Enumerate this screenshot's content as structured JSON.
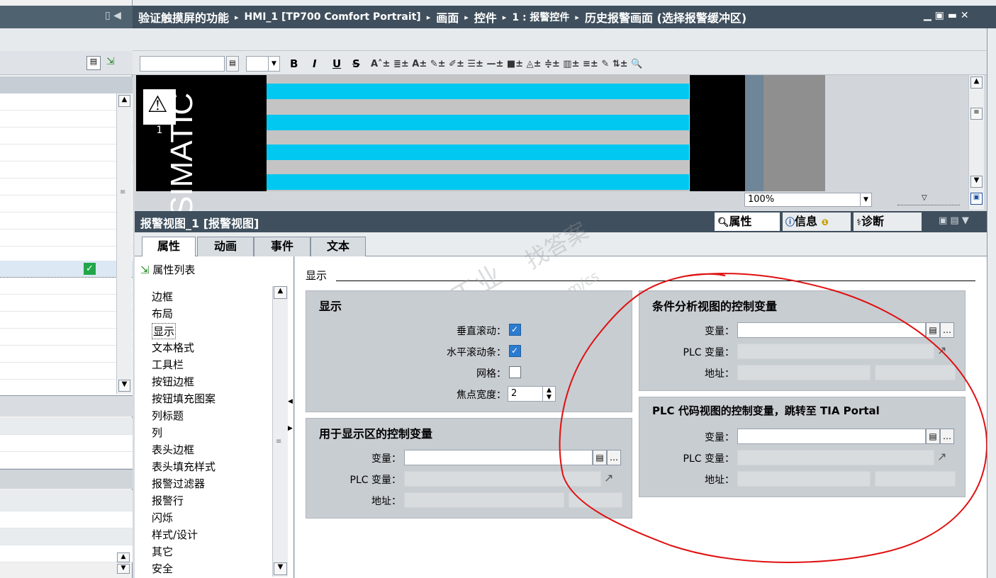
{
  "breadcrumb": {
    "items": [
      "验证触摸屏的功能",
      "HMI_1 [TP700 Comfort Portrait]",
      "画面",
      "控件",
      "1 : 报警控件",
      "历史报警画面 (选择报警缓冲区)"
    ],
    "separator": "▸"
  },
  "toolbar": {
    "bold": "B",
    "italic": "I",
    "underline": "U",
    "strike": "S"
  },
  "canvas": {
    "brand_text": "SIMATIC",
    "badge_number": "1",
    "zoom": "100%"
  },
  "properties_bar": {
    "title": "报警视图_1 [报警视图]",
    "tab_properties": "属性",
    "tab_info": "信息",
    "tab_diag": "诊断"
  },
  "tabs": [
    "属性",
    "动画",
    "事件",
    "文本"
  ],
  "nav": {
    "header": "属性列表",
    "items": [
      "边框",
      "布局",
      "显示",
      "文本格式",
      "工具栏",
      "按钮边框",
      "按钮填充图案",
      "列标题",
      "列",
      "表头边框",
      "表头填充样式",
      "报警过滤器",
      "报警行",
      "闪烁",
      "样式/设计",
      "其它",
      "安全"
    ]
  },
  "section_title": "显示",
  "display_group": {
    "title": "显示",
    "vscroll_label": "垂直滚动：",
    "hscroll_label": "水平滚动条：",
    "grid_label": "网格：",
    "focus_label": "焦点宽度：",
    "focus_value": "2"
  },
  "display_area_group": {
    "title": "用于显示区的控制变量",
    "var_label": "变量：",
    "plc_label": "PLC 变量：",
    "addr_label": "地址："
  },
  "condition_group": {
    "title": "条件分析视图的控制变量",
    "var_label": "变量：",
    "plc_label": "PLC 变量：",
    "addr_label": "地址："
  },
  "plc_code_group": {
    "title": "PLC 代码视图的控制变量，跳转至 TIA Portal",
    "var_label": "变量：",
    "plc_label": "PLC 变量：",
    "addr_label": "地址："
  },
  "watermark": {
    "line1": "西门子工业",
    "line2": "support.industry.siemens.com/cs",
    "line3": "找答案"
  },
  "colors": {
    "title_bar": "#3f4f5d",
    "accent_cyan": "#00c8f0",
    "annotation_red": "#e01010"
  }
}
